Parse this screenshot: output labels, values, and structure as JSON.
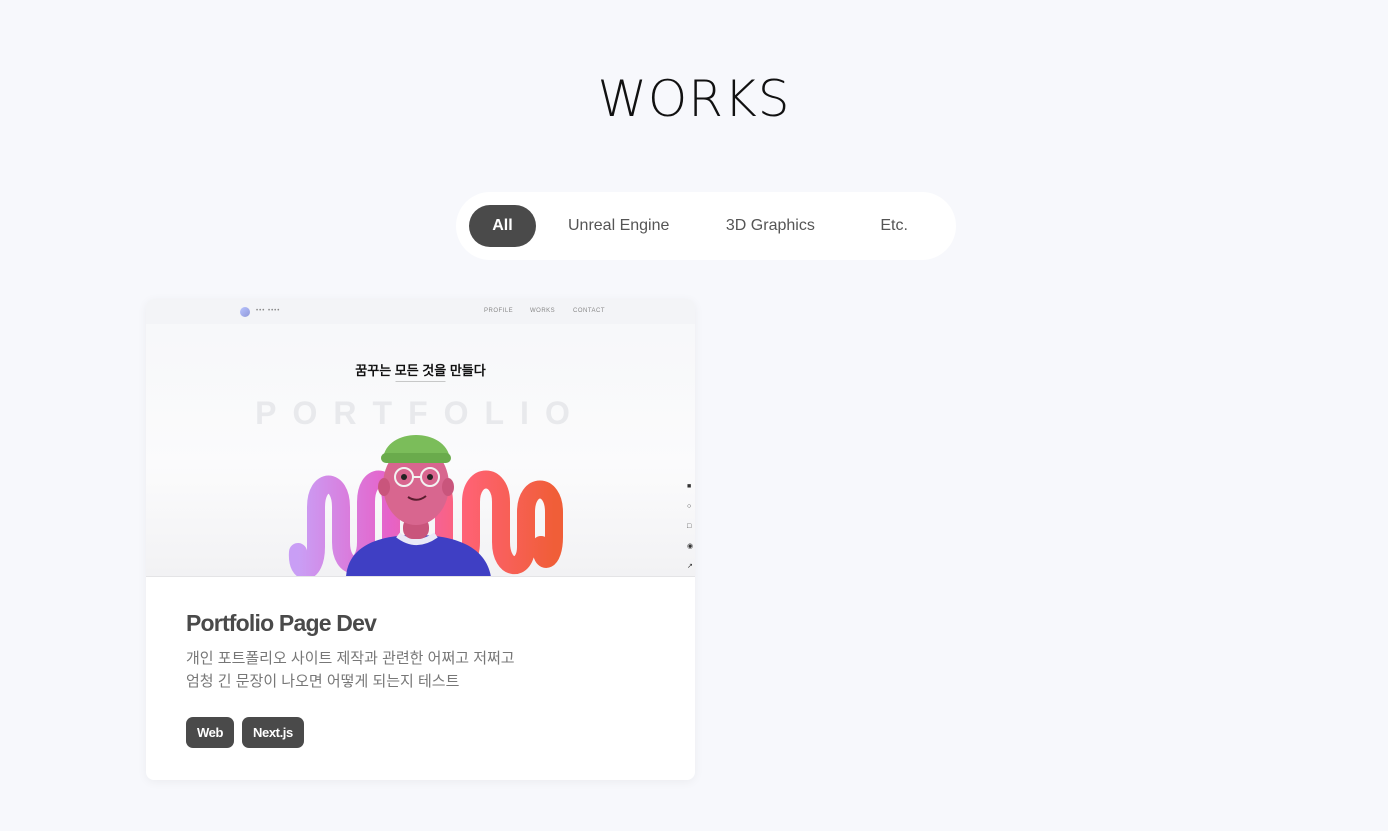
{
  "page": {
    "title": "WORKS"
  },
  "filters": [
    {
      "label": "All",
      "active": true
    },
    {
      "label": "Unreal Engine",
      "active": false
    },
    {
      "label": "3D Graphics",
      "active": false
    },
    {
      "label": "Etc.",
      "active": false
    }
  ],
  "card": {
    "thumbnail": {
      "headline": "꿈꾸는 모든 것을 만들다",
      "watermark": "PORTFOLIO",
      "nav_links": [
        "PROFILE",
        "WORKS",
        "CONTACT"
      ]
    },
    "title": "Portfolio Page Dev",
    "description_line1": "개인 포트폴리오 사이트 제작과 관련한 어쩌고 저쩌고",
    "description_line2": "엄청 긴 문장이 나오면 어떻게 되는지 테스트",
    "tags": [
      "Web",
      "Next.js"
    ]
  },
  "colors": {
    "background": "#f7f8fc",
    "accent": "#4a4a4a",
    "card": "#ffffff"
  }
}
